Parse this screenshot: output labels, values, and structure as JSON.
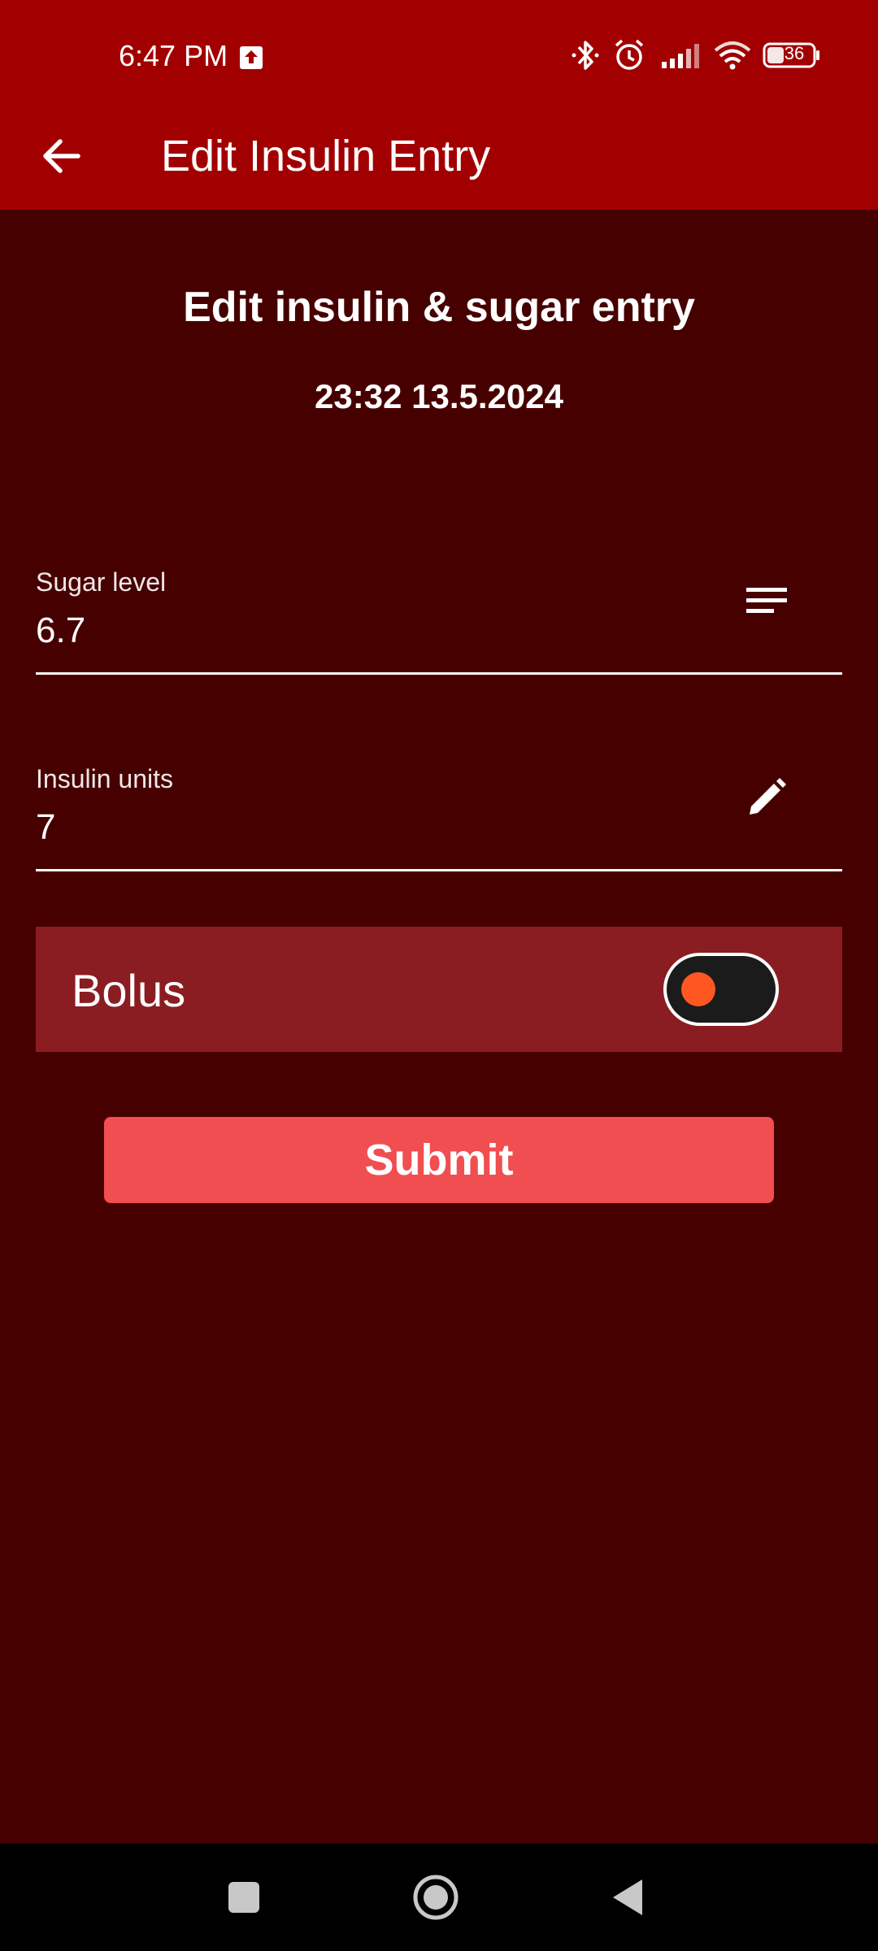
{
  "status_bar": {
    "time": "6:47 PM",
    "battery": "36",
    "icons": [
      "upload-icon",
      "bluetooth-icon",
      "alarm-icon",
      "signal-icon",
      "wifi-icon",
      "battery-icon"
    ]
  },
  "app_bar": {
    "title": "Edit Insulin Entry",
    "back_icon": "arrow-back-icon"
  },
  "main": {
    "heading": "Edit insulin & sugar entry",
    "datetime": "23:32  13.5.2024",
    "sugar_field": {
      "label": "Sugar level",
      "value": "6.7",
      "icon": "list-icon"
    },
    "insulin_field": {
      "label": "Insulin units",
      "value": "7",
      "icon": "pencil-icon"
    },
    "bolus": {
      "label": "Bolus",
      "toggle_state": "off"
    },
    "submit_label": "Submit"
  },
  "colors": {
    "status_bar": "#a20000",
    "background": "#470000",
    "bolus_row": "#8a1d22",
    "submit_button": "#f04e50",
    "toggle_knob": "#ff5722"
  },
  "nav_bar": {
    "items": [
      "recents-square-icon",
      "home-circle-icon",
      "back-triangle-icon"
    ]
  }
}
